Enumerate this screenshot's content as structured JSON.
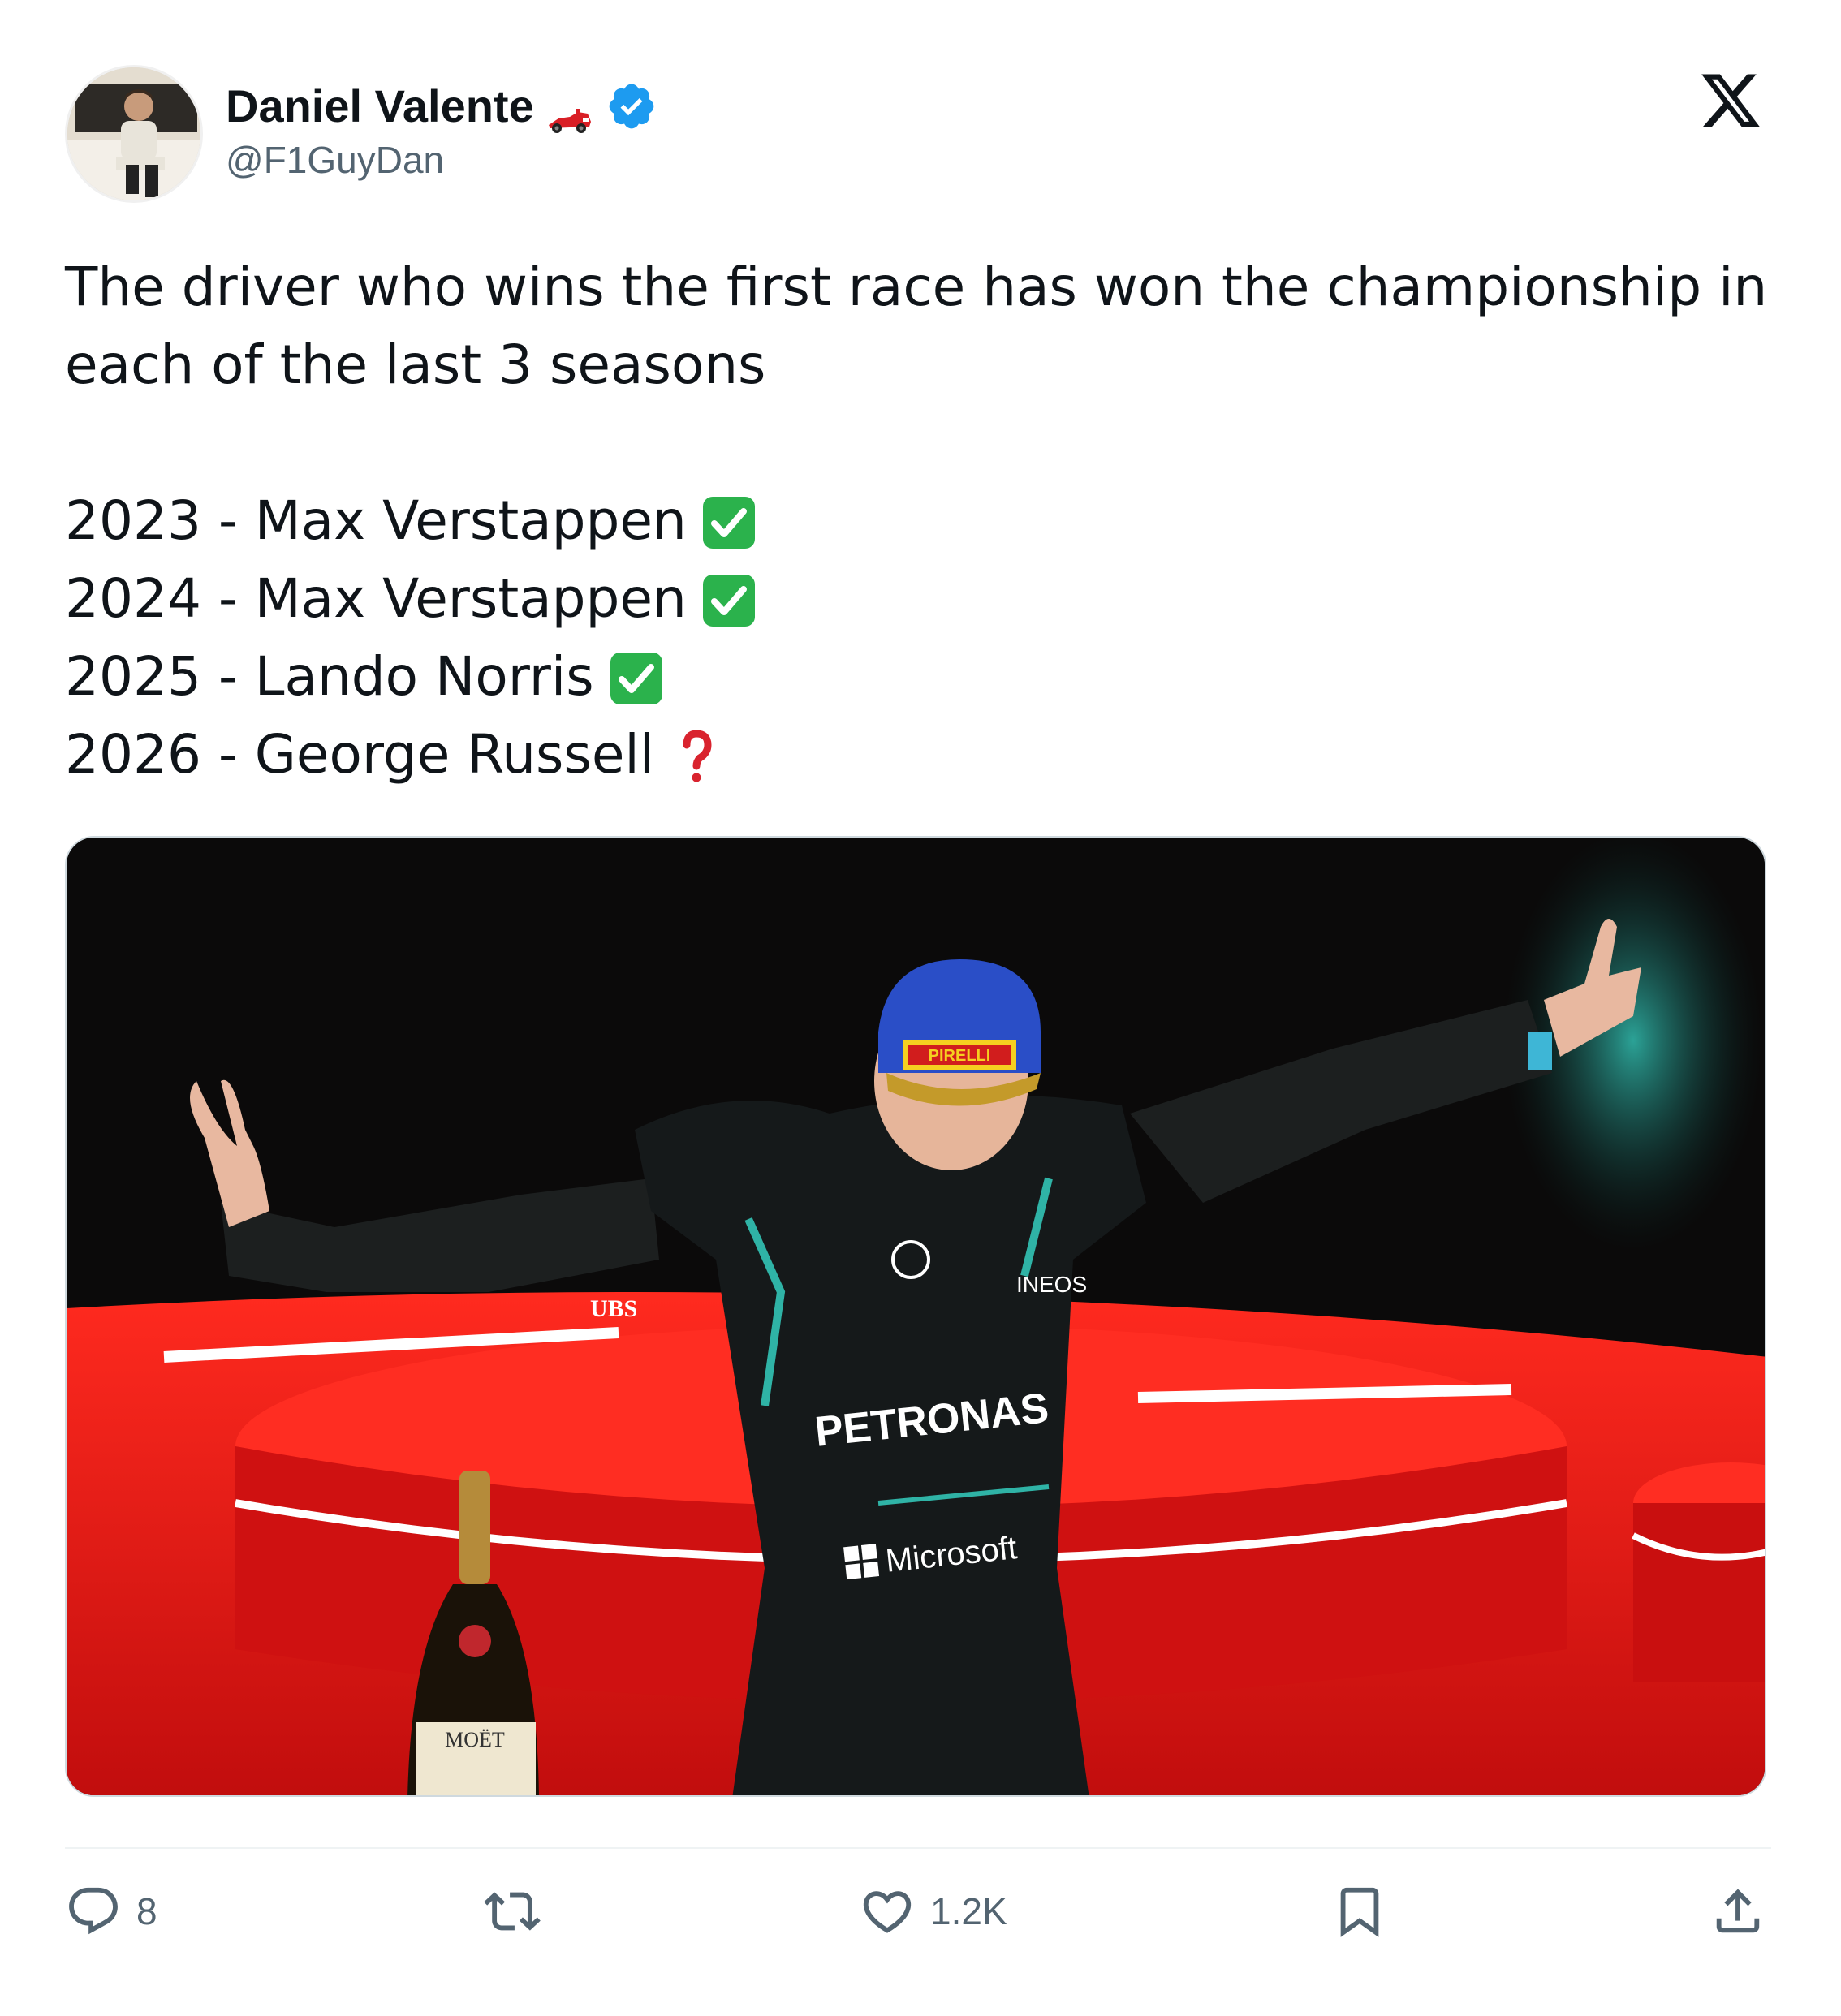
{
  "author": {
    "name": "Daniel Valente",
    "handle": "@F1GuyDan",
    "verified": true,
    "name_emoji": "race-car-icon"
  },
  "brand_logo": "x-logo",
  "tweet": {
    "text": "The driver who wins the first race has won the championship in each of the last 3 seasons",
    "list": [
      {
        "line": "2023 - Max Verstappen",
        "status_icon": "check-mark-button-icon"
      },
      {
        "line": "2024 - Max Verstappen",
        "status_icon": "check-mark-button-icon"
      },
      {
        "line": "2025 - Lando Norris",
        "status_icon": "check-mark-button-icon"
      },
      {
        "line": "2026 - George Russell",
        "status_icon": "red-question-mark-icon"
      }
    ]
  },
  "media": {
    "sponsor_text": {
      "petronas": "PETRONAS",
      "microsoft": "Microsoft",
      "ubs": "UBS",
      "ineos": "INEOS",
      "pirelli": "PIRELLI",
      "moet": "MOËT"
    }
  },
  "actions": {
    "replies": "8",
    "retweets": "",
    "likes": "1.2K"
  },
  "colors": {
    "text": "#0f1419",
    "secondary": "#536471",
    "verified": "#1d9bf0",
    "check_green": "#2bb24c",
    "question_red": "#d9232e",
    "podium_red": "#e31b1b"
  }
}
